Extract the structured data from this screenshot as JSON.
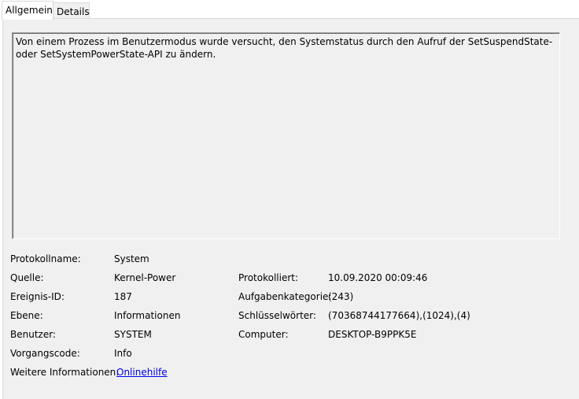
{
  "tabs": {
    "general": "Allgemein",
    "details": "Details"
  },
  "description": "Von einem Prozess im Benutzermodus wurde versucht, den Systemstatus durch den Aufruf der SetSuspendState- oder SetSystemPowerState-API zu ändern.",
  "fields": {
    "log_name": {
      "label": "Protokollname:",
      "value": "System"
    },
    "source": {
      "label": "Quelle:",
      "value": "Kernel-Power"
    },
    "event_id": {
      "label": "Ereignis-ID:",
      "value": "187"
    },
    "level": {
      "label": "Ebene:",
      "value": "Informationen"
    },
    "user": {
      "label": "Benutzer:",
      "value": "SYSTEM"
    },
    "opcode": {
      "label": "Vorgangscode:",
      "value": "Info"
    },
    "more_info": {
      "label": "Weitere Informationen:",
      "value": "Onlinehilfe"
    },
    "logged": {
      "label": "Protokolliert:",
      "value": "10.09.2020 00:09:46"
    },
    "task_category": {
      "label": "Aufgabenkategorie:",
      "value": "(243)"
    },
    "keywords": {
      "label": "Schlüsselwörter:",
      "value": "(70368744177664),(1024),(4)"
    },
    "computer": {
      "label": "Computer:",
      "value": "DESKTOP-B9PPK5E"
    }
  }
}
